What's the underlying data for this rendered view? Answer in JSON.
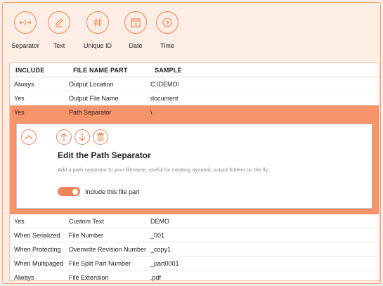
{
  "toolbar": {
    "items": [
      {
        "label": "Separator",
        "icon": "separator-icon"
      },
      {
        "label": "Text",
        "icon": "pencil-icon"
      },
      {
        "label": "Unique ID",
        "icon": "hash-icon"
      },
      {
        "label": "Date",
        "icon": "calendar-icon"
      },
      {
        "label": "Time",
        "icon": "clock-arrow-icon"
      }
    ],
    "date_icon_text": "31"
  },
  "table": {
    "headers": {
      "include": "INCLUDE",
      "part": "FILE NAME PART",
      "sample": "SAMPLE"
    },
    "rows": [
      {
        "include": "Always",
        "part": "Output Location",
        "sample": "C:\\DEMO\\"
      },
      {
        "include": "Yes",
        "part": "Output File Name",
        "sample": "document"
      },
      {
        "include": "Yes",
        "part": "Path Separator",
        "sample": "\\"
      },
      {
        "include": "Yes",
        "part": "Custom Text",
        "sample": "DEMO"
      },
      {
        "include": "When Serialized",
        "part": "File Number",
        "sample": "_001"
      },
      {
        "include": "When Protecting",
        "part": "Overwrite Revision Number",
        "sample": "_copy1"
      },
      {
        "include": "When Multipaged",
        "part": "File Split Part Number",
        "sample": "_part0001"
      },
      {
        "include": "Always",
        "part": "File Extension",
        "sample": ".pdf"
      }
    ]
  },
  "detail": {
    "title": "Edit the Path Separator",
    "description": "Add a path separator to your filename, useful for creating dynamic output folders on the fly.",
    "toggle_label": "Include this file part",
    "toggle_on": true
  },
  "colors": {
    "accent": "#f0845a",
    "selected_row": "#f6946b",
    "background": "#fdeee5"
  }
}
